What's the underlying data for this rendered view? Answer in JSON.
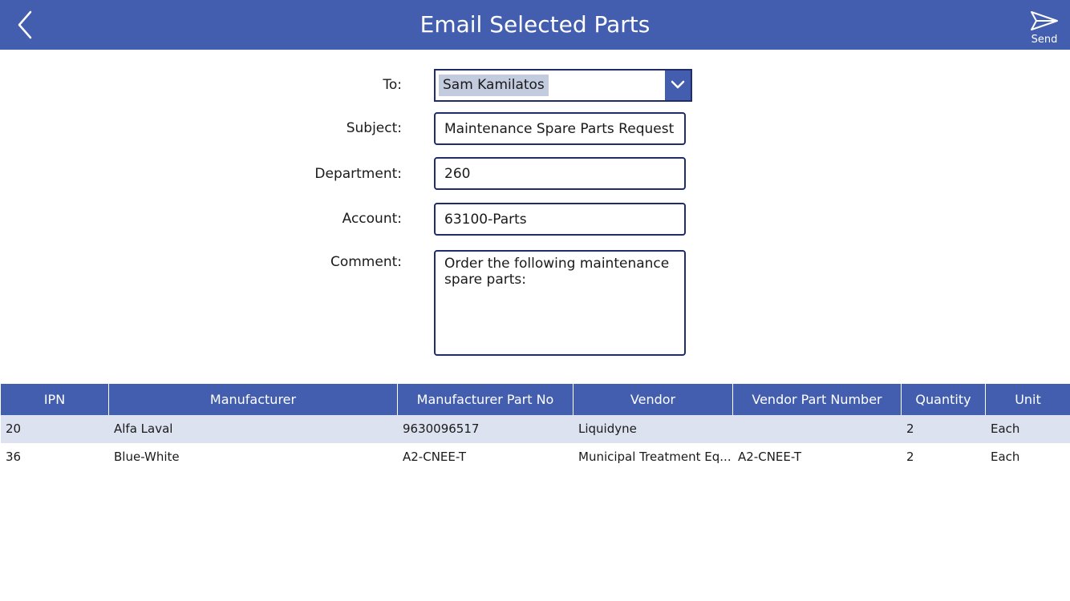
{
  "header": {
    "title": "Email Selected Parts",
    "send_label": "Send",
    "back_icon": "chevron-left-icon",
    "send_icon": "paper-plane-icon",
    "background_color": "#435eaf"
  },
  "form": {
    "to": {
      "label": "To:",
      "value": "Sam Kamilatos"
    },
    "subject": {
      "label": "Subject:",
      "value": "Maintenance Spare Parts Request"
    },
    "department": {
      "label": "Department:",
      "value": "260"
    },
    "account": {
      "label": "Account:",
      "value": "63100-Parts"
    },
    "comment": {
      "label": "Comment:",
      "value": "Order the following maintenance spare parts:"
    }
  },
  "table": {
    "columns": [
      "IPN",
      "Manufacturer",
      "Manufacturer Part No",
      "Vendor",
      "Vendor Part Number",
      "Quantity",
      "Unit"
    ],
    "rows": [
      [
        "20",
        "Alfa Laval",
        "9630096517",
        "Liquidyne",
        "",
        "2",
        "Each"
      ],
      [
        "36",
        "Blue-White",
        "A2-CNEE-T",
        "Municipal Treatment Eq...",
        "A2-CNEE-T",
        "2",
        "Each"
      ]
    ]
  }
}
